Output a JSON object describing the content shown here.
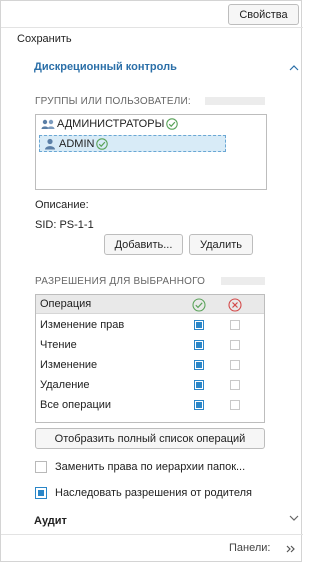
{
  "toolbar": {
    "properties_button": "Свойства"
  },
  "actions": {
    "save": "Сохранить"
  },
  "discretionary": {
    "title": "Дискреционный контроль",
    "groups_label": "ГРУППЫ ИЛИ ПОЛЬЗОВАТЕЛИ:",
    "users": [
      {
        "name": "АДМИНИСТРАТОРЫ",
        "type": "group",
        "selected": false
      },
      {
        "name": "ADMIN",
        "type": "user",
        "selected": true
      }
    ],
    "description_label": "Описание:",
    "sid": "SID: PS-1-1",
    "add_button": "Добавить...",
    "delete_button": "Удалить",
    "permissions_label": "РАЗРЕШЕНИЯ ДЛЯ ВЫБРАННОГО",
    "permissions_header": "Операция",
    "permissions": [
      {
        "name": "Изменение прав",
        "allow": true,
        "deny": false
      },
      {
        "name": "Чтение",
        "allow": true,
        "deny": false
      },
      {
        "name": "Изменение",
        "allow": true,
        "deny": false
      },
      {
        "name": "Удаление",
        "allow": true,
        "deny": false
      },
      {
        "name": "Все операции",
        "allow": true,
        "deny": false
      }
    ],
    "full_list_button": "Отобразить полный список операций",
    "replace_rights_label": "Заменить права по иерархии папок...",
    "replace_rights_checked": false,
    "inherit_label": "Наследовать разрешения от родителя",
    "inherit_checked": true
  },
  "audit": {
    "title": "Аудит"
  },
  "footer": {
    "panels_label": "Панели:"
  },
  "colors": {
    "accent": "#2a86c8",
    "link": "#2b6fa8",
    "allow": "#5aa35a",
    "deny": "#d44a4a"
  },
  "icons": {
    "section_collapse": "chevron-up-icon",
    "audit_expand": "chevron-down-icon",
    "group": "user-group-icon",
    "user": "user-icon",
    "ok": "check-circle-icon",
    "deny": "cross-circle-icon",
    "panels": "double-chevron-right-icon"
  }
}
